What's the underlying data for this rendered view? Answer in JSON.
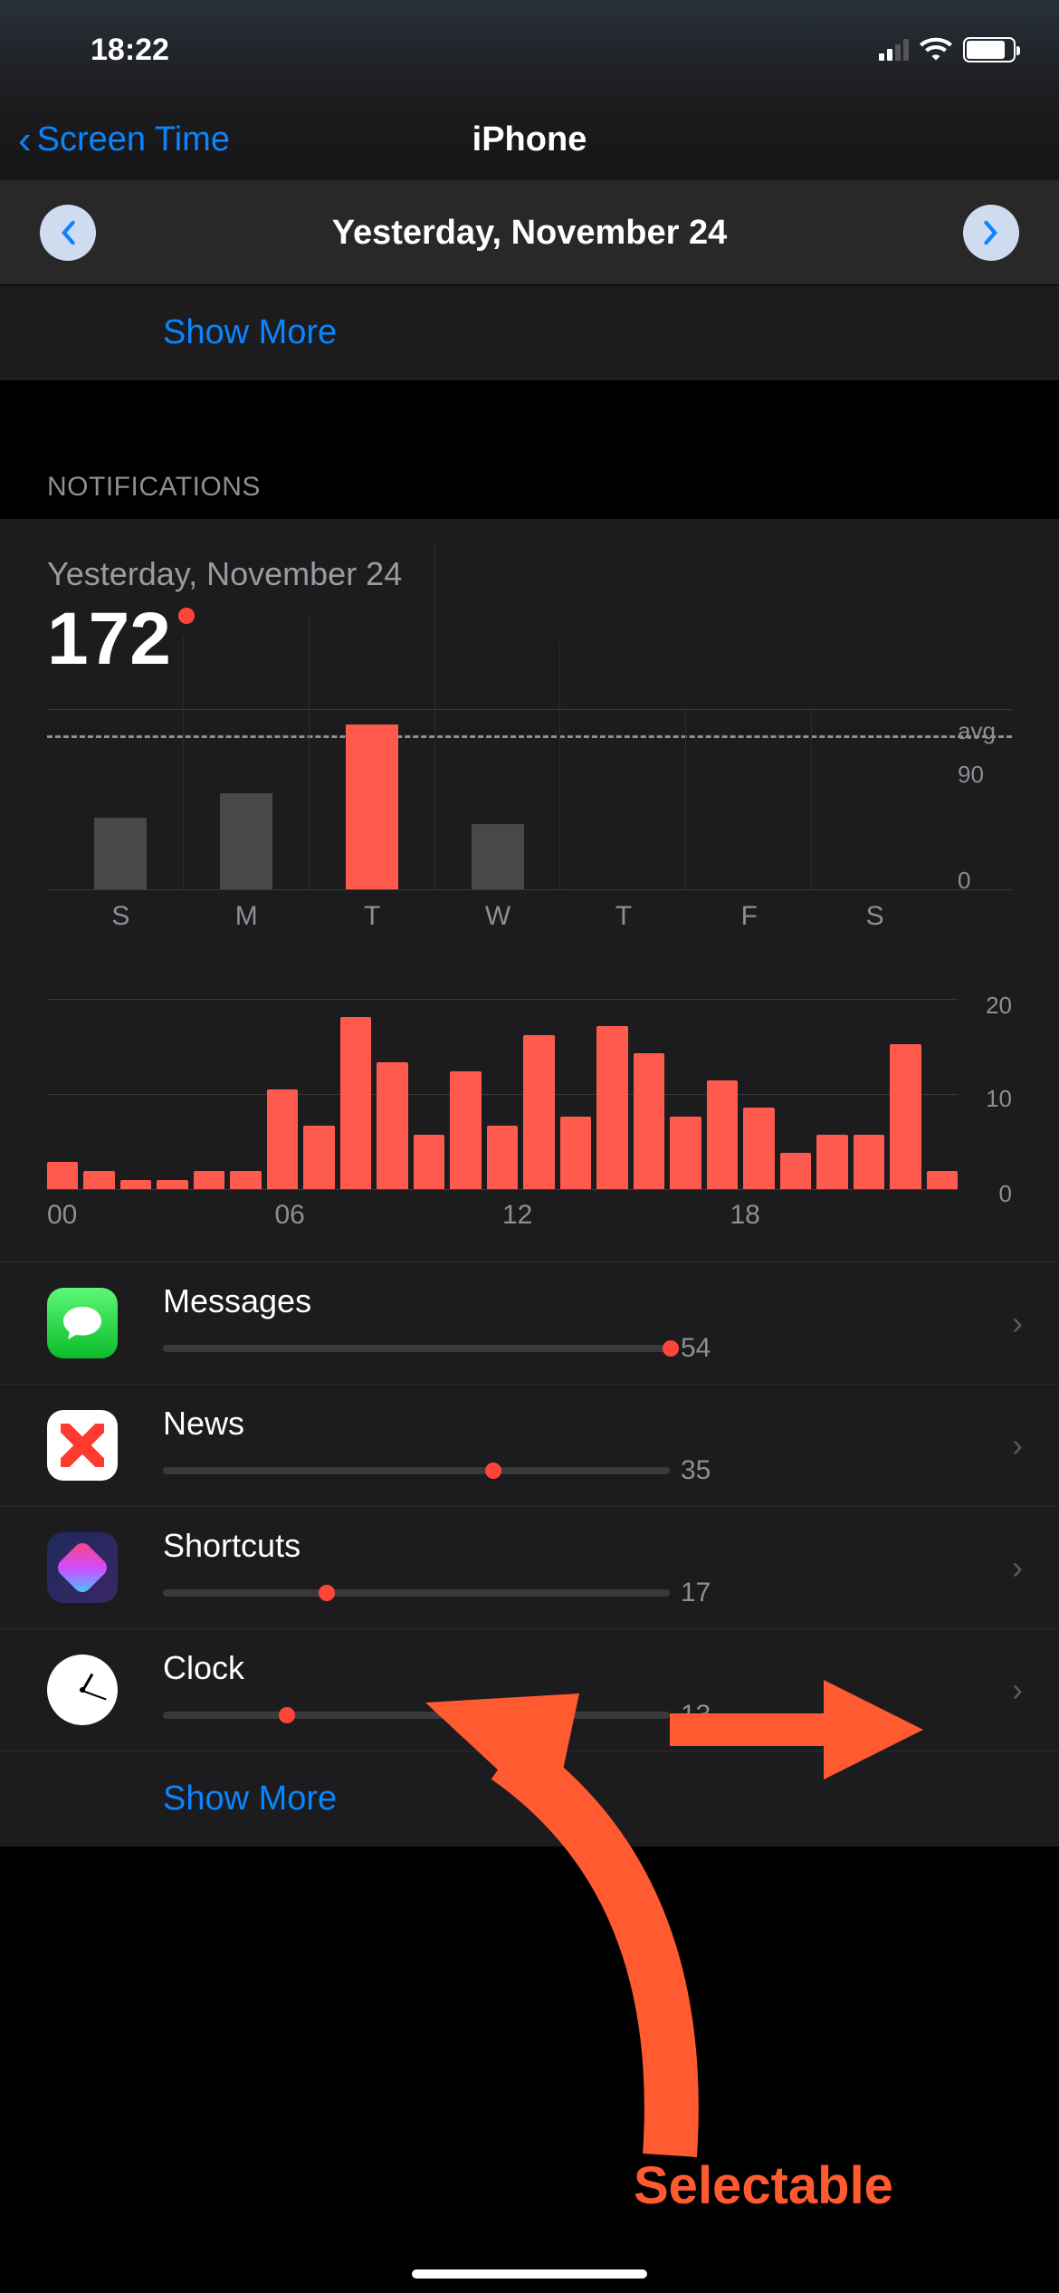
{
  "status": {
    "time": "18:22"
  },
  "nav": {
    "back_label": "Screen Time",
    "title": "iPhone"
  },
  "date_selector": {
    "label": "Yesterday, November 24"
  },
  "show_more": "Show More",
  "section": {
    "header": "NOTIFICATIONS"
  },
  "summary": {
    "subtitle": "Yesterday, November 24",
    "total": "172"
  },
  "chart_data": [
    {
      "type": "bar",
      "description": "Notifications per weekday",
      "categories": [
        "S",
        "M",
        "T",
        "W",
        "T",
        "F",
        "S"
      ],
      "values": [
        75,
        100,
        172,
        68,
        0,
        0,
        0
      ],
      "highlight_index": 2,
      "avg_label": "avg",
      "ylim": [
        0,
        180
      ],
      "y_ticks": [
        "90",
        "0"
      ]
    },
    {
      "type": "bar",
      "description": "Notifications per hour (Tuesday)",
      "x_ticks": [
        "00",
        "06",
        "12",
        "18"
      ],
      "values": [
        3,
        2,
        1,
        1,
        2,
        2,
        11,
        7,
        19,
        14,
        6,
        13,
        7,
        17,
        8,
        18,
        15,
        8,
        12,
        9,
        4,
        6,
        6,
        16,
        2
      ],
      "ylim": [
        0,
        20
      ],
      "y_ticks": [
        "20",
        "10",
        "0"
      ]
    }
  ],
  "apps": [
    {
      "name": "Messages",
      "count": "54",
      "fill_pct": 100
    },
    {
      "name": "News",
      "count": "35",
      "fill_pct": 65
    },
    {
      "name": "Shortcuts",
      "count": "17",
      "fill_pct": 32
    },
    {
      "name": "Clock",
      "count": "13",
      "fill_pct": 24
    }
  ],
  "annotation": {
    "label": "Selectable"
  }
}
